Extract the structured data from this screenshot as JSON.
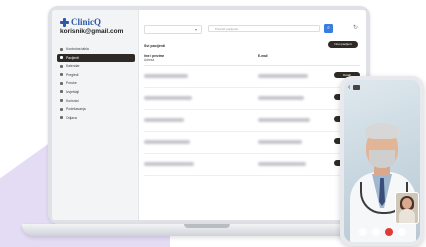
{
  "app": {
    "logo_text": "ClinicQ",
    "user_email": "korisnik@gmail.com"
  },
  "sidebar": {
    "items": [
      {
        "label": "Kontrolna tabla",
        "active": false
      },
      {
        "label": "Pacijenti",
        "active": true
      },
      {
        "label": "Kalendar",
        "active": false
      },
      {
        "label": "Pregledi",
        "active": false
      },
      {
        "label": "Poruke",
        "active": false
      },
      {
        "label": "Izvještaji",
        "active": false
      },
      {
        "label": "Korisnici",
        "active": false
      },
      {
        "label": "Podešavanja",
        "active": false
      },
      {
        "label": "Odjava",
        "active": false
      }
    ]
  },
  "toolbar": {
    "search_placeholder": "Pretraži pacijente",
    "search_icon": "search-icon",
    "refresh_icon": "refresh-icon"
  },
  "main": {
    "title": "Svi pacijenti",
    "new_button_label": "Novi pacijent",
    "columns": [
      {
        "label": "Ime i prezime",
        "sub": "Adresa"
      },
      {
        "label": "E-mail",
        "sub": ""
      }
    ],
    "row_button_label": "Detalji",
    "row_count": 5
  },
  "phone": {
    "back_icon": "chevron-left-icon",
    "camera_icon": "camera-icon"
  },
  "colors": {
    "accent": "#2c5aa8",
    "dark": "#2f2a25",
    "bg_shape": "#e4dcf4",
    "end_call": "#e53935"
  }
}
